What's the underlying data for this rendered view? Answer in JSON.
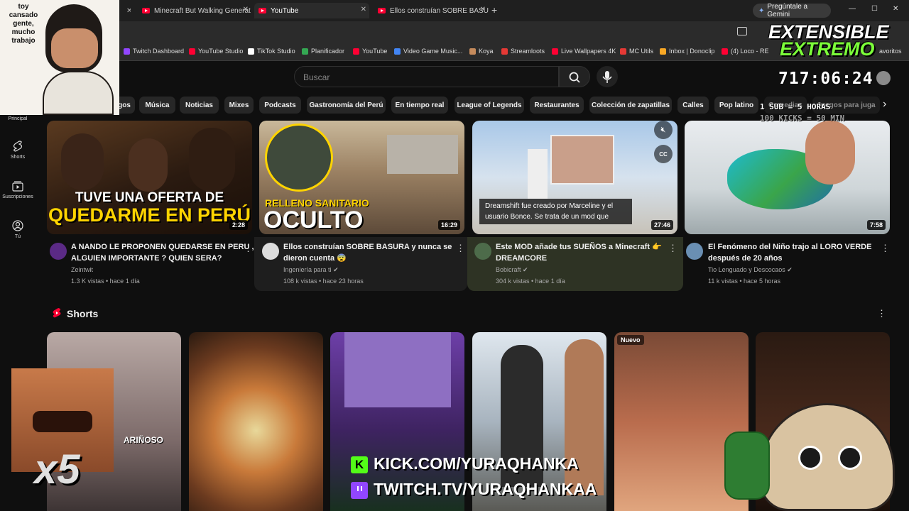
{
  "browser": {
    "tabs": [
      {
        "label": "Minecraft But Walking Generat…"
      },
      {
        "label": "YouTube"
      },
      {
        "label": "Ellos construían SOBRE BASUR…"
      }
    ],
    "new_tab": "+",
    "gemini_label": "Pregúntale a Gemini",
    "window_controls": {
      "minimize": "—",
      "maximize": "☐",
      "close": "✕"
    },
    "bookmarks": [
      {
        "label": "Twitch Dashboard",
        "color": "#9146ff"
      },
      {
        "label": "YouTube Studio",
        "color": "#ff0033"
      },
      {
        "label": "TikTok Studio",
        "color": "#ffffff"
      },
      {
        "label": "Planificador",
        "color": "#34a853"
      },
      {
        "label": "YouTube",
        "color": "#ff0033"
      },
      {
        "label": "Video Game Music...",
        "color": "#4285f4"
      },
      {
        "label": "Koya",
        "color": "#c58b5c"
      },
      {
        "label": "Streamloots",
        "color": "#e53935"
      },
      {
        "label": "Live Wallpapers 4K",
        "color": "#ff0033"
      },
      {
        "label": "MC Utils",
        "color": "#e53935"
      },
      {
        "label": "Inbox | Donoclip",
        "color": "#f9a825"
      },
      {
        "label": "(4) Loco - RE",
        "color": "#ff0033"
      }
    ],
    "bookmarks_tail": "avoritos"
  },
  "youtube": {
    "search_placeholder": "Buscar",
    "chips": [
      "gos",
      "Música",
      "Noticias",
      "Mixes",
      "Podcasts",
      "Gastronomía del Perú",
      "En tiempo real",
      "League of Legends",
      "Restaurantes",
      "Colección de zapatillas",
      "Calles",
      "Pop latino",
      "Comedias",
      "Juegos para juga"
    ],
    "sidebar": [
      {
        "label": "Principal",
        "icon": "home-icon"
      },
      {
        "label": "Shorts",
        "icon": "shorts-icon"
      },
      {
        "label": "Suscripciones",
        "icon": "subscriptions-icon"
      },
      {
        "label": "Tú",
        "icon": "you-icon"
      }
    ],
    "videos": [
      {
        "title_line1": "A NANDO LE PROPONEN QUEDARSE EN PERU ,",
        "title_line2": "ALGUIEN IMPORTANTE ? QUIEN SERA?",
        "channel": "Zeintwit",
        "meta": "1.3 K vistas • hace 1 día",
        "duration": "2:28",
        "thumb_caption_1": "TUVE UNA OFERTA DE",
        "thumb_caption_2": "QUEDARME EN PERÚ"
      },
      {
        "title_line1": "Ellos construían SOBRE BASURA y nunca se",
        "title_line2": "dieron cuenta 😨",
        "channel": "Ingeniería para ti",
        "meta": "108 k vistas • hace 23 horas",
        "duration": "16:29",
        "thumb_caption_1": "RELLENO SANITARIO",
        "thumb_caption_2": "OCULTO"
      },
      {
        "title_line1": "Este MOD añade tus SUEÑOS a Minecraft 👉",
        "title_line2": "DREAMCORE",
        "channel": "Bobicraft",
        "meta": "304 k vistas • hace 1 día",
        "duration": "27:46",
        "caption_line1": "Dreamshift fue creado por Marceline y el",
        "caption_line2": "usuario Bonce. Se trata de un mod que",
        "mute_label": "muted",
        "cc_label": "CC"
      },
      {
        "title_line1": "El Fenómeno del Niño trajo al LORO VERDE",
        "title_line2": "después de 20 años",
        "channel": "Tio Lenguado y Descocaos",
        "meta": "11 k vistas • hace 5 horas",
        "duration": "7:58"
      }
    ],
    "shorts_heading": "Shorts",
    "shorts_badge": "Nuevo",
    "shorts_caption": "ARIÑOSO"
  },
  "stream_overlay": {
    "top_left_text": "toy cansado gente, mucho trabajo",
    "brand_line1": "EXTENSIBLE",
    "brand_line2": "EXTREMO",
    "timer": "717:06:24",
    "sub_line1": "1 SUB = 5 HORAS",
    "sub_line2": "100 KICKS = 50 MIN",
    "multiplier": "x5",
    "kick_url": "KICK.COM/YURAQHANKA",
    "twitch_url": "TWITCH.TV/YURAQHANKAA"
  },
  "colors": {
    "bg": "#0f0f0f",
    "accent_red": "#ff0033",
    "brand_green": "#7cff3a",
    "kick_green": "#53fc18",
    "twitch_purple": "#9146ff"
  }
}
